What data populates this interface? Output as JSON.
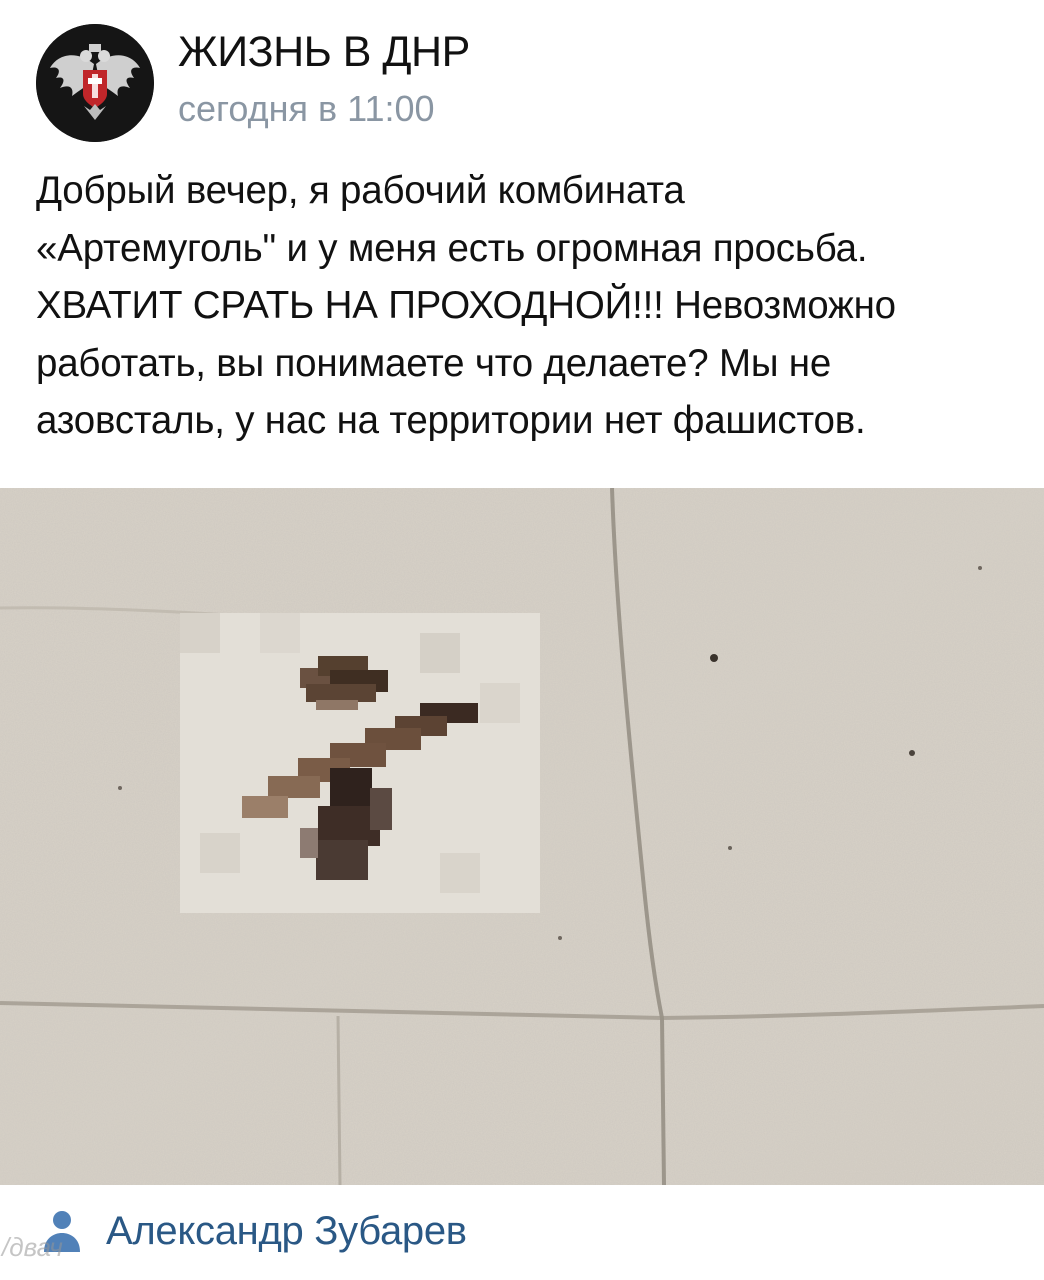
{
  "header": {
    "group_name": "ЖИЗНЬ В ДНР",
    "post_time": "сегодня в 11:00",
    "avatar_icon": "dnr-eagle-emblem-icon"
  },
  "post": {
    "text": "Добрый вечер, я рабочий комбината\n«Артемуголь\" и у меня есть огромная просьба.\nХВАТИТ СРАТЬ НА ПРОХОДНОЙ!!! Невозможно\nработать, вы понимаете что делаете? Мы не\nазовсталь, у нас на территории нет фашистов.",
    "photo_description_icon": "pixelated-photo"
  },
  "footer": {
    "author_icon": "person-icon",
    "author_name": "Александр Зубарев",
    "watermark": "/двач"
  },
  "colors": {
    "name_text": "#111111",
    "time_text": "#8a96a3",
    "author_link": "#2a5885"
  }
}
